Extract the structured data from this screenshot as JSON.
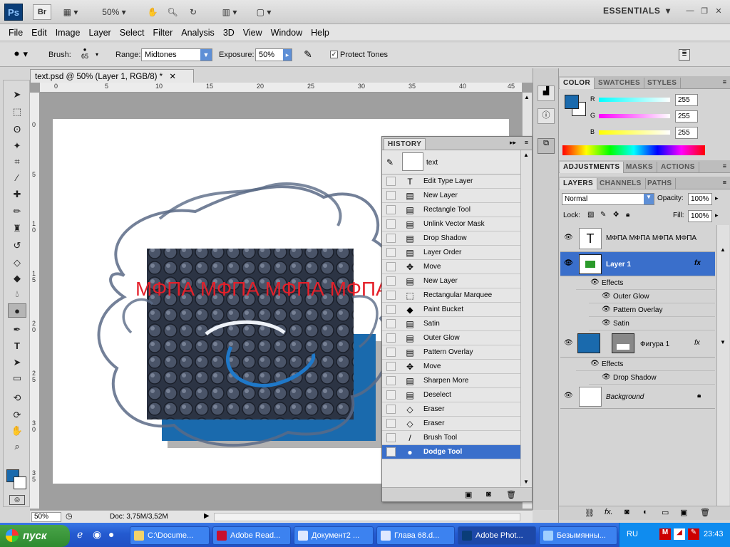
{
  "app": {
    "logo": "Ps",
    "bridge": "Br",
    "zoom": "50%",
    "workspace": "ESSENTIALS"
  },
  "menu": [
    "File",
    "Edit",
    "Image",
    "Layer",
    "Select",
    "Filter",
    "Analysis",
    "3D",
    "View",
    "Window",
    "Help"
  ],
  "options": {
    "brush_label": "Brush:",
    "brush_size": "65",
    "range_label": "Range:",
    "range_value": "Midtones",
    "exposure_label": "Exposure:",
    "exposure_value": "50%",
    "protect_tones": "Protect Tones"
  },
  "document": {
    "tab_title": "text.psd @ 50% (Layer 1, RGB/8) *",
    "canvas_text": "МФПА МФПА МФПА МФПА",
    "ruler_h": [
      "0",
      "5",
      "10",
      "15",
      "20",
      "25",
      "30",
      "35",
      "40",
      "45"
    ],
    "ruler_v": [
      "0",
      "5",
      "1\n0",
      "1\n5",
      "2\n0",
      "2\n5",
      "3\n0",
      "3\n5"
    ],
    "status_zoom": "50%",
    "status_doc": "Doc: 3,75M/3,52M"
  },
  "history": {
    "tab": "HISTORY",
    "snapshot": "text",
    "items": [
      {
        "label": "Edit Type Layer",
        "icon": "T"
      },
      {
        "label": "New Layer",
        "icon": "▤"
      },
      {
        "label": "Rectangle Tool",
        "icon": "▤"
      },
      {
        "label": "Unlink Vector Mask",
        "icon": "▤"
      },
      {
        "label": "Drop Shadow",
        "icon": "▤"
      },
      {
        "label": "Layer Order",
        "icon": "▤"
      },
      {
        "label": "Move",
        "icon": "✥"
      },
      {
        "label": "New Layer",
        "icon": "▤"
      },
      {
        "label": "Rectangular Marquee",
        "icon": "⬚"
      },
      {
        "label": "Paint Bucket",
        "icon": "◆"
      },
      {
        "label": "Satin",
        "icon": "▤"
      },
      {
        "label": "Outer Glow",
        "icon": "▤"
      },
      {
        "label": "Pattern Overlay",
        "icon": "▤"
      },
      {
        "label": "Move",
        "icon": "✥"
      },
      {
        "label": "Sharpen More",
        "icon": "▤"
      },
      {
        "label": "Deselect",
        "icon": "▤"
      },
      {
        "label": "Eraser",
        "icon": "◇"
      },
      {
        "label": "Eraser",
        "icon": "◇"
      },
      {
        "label": "Brush Tool",
        "icon": "/"
      },
      {
        "label": "Dodge Tool",
        "icon": "●"
      }
    ]
  },
  "color_panel": {
    "tabs": [
      "COLOR",
      "SWATCHES",
      "STYLES"
    ],
    "r_label": "R",
    "g_label": "G",
    "b_label": "B",
    "r": "255",
    "g": "255",
    "b": "255",
    "foreground": "#1a6aad"
  },
  "adjust_tabs": [
    "ADJUSTMENTS",
    "MASKS",
    "ACTIONS"
  ],
  "layers_panel": {
    "tabs": [
      "LAYERS",
      "CHANNELS",
      "PATHS"
    ],
    "blend_mode": "Normal",
    "opacity_label": "Opacity:",
    "opacity": "100%",
    "lock_label": "Lock:",
    "fill_label": "Fill:",
    "fill": "100%",
    "layers": {
      "text_layer": "МФПА МФПА МФПА МФПА",
      "layer1": "Layer 1",
      "effects": "Effects",
      "outer_glow": "Outer Glow",
      "pattern_overlay": "Pattern Overlay",
      "satin": "Satin",
      "figura": "Фигура 1",
      "effects2": "Effects",
      "drop_shadow": "Drop Shadow",
      "background": "Background",
      "fx": "fx"
    }
  },
  "taskbar": {
    "start": "пуск",
    "tasks": [
      "C:\\Docume...",
      "Adobe Read...",
      "Документ2 ...",
      "Глава 68.d...",
      "Adobe Phot...",
      "Безымянны..."
    ],
    "lang": "RU",
    "time": "23:43"
  }
}
